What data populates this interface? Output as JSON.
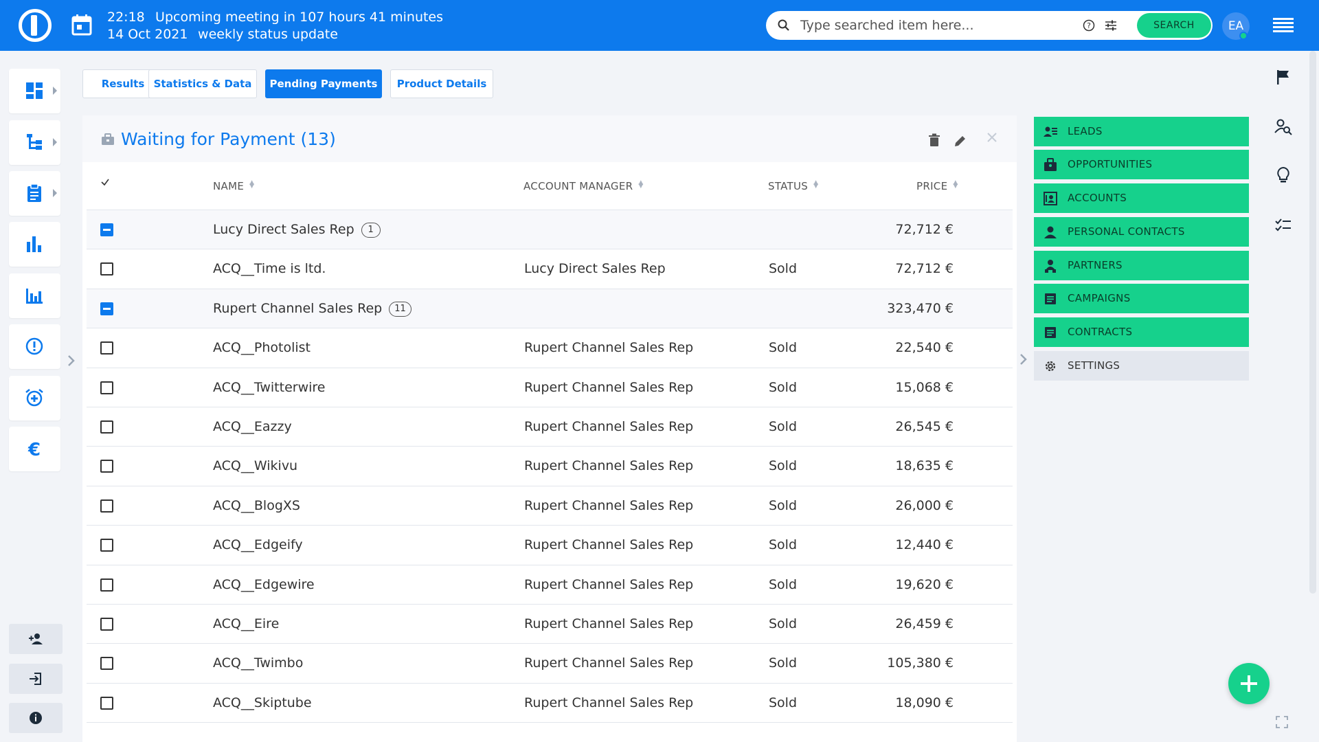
{
  "header": {
    "time": "22:18",
    "date": "14 Oct 2021",
    "meeting_line1": "Upcoming meeting in 107 hours 41 minutes",
    "meeting_line2": "weekly status update",
    "search_placeholder": "Type searched item here...",
    "search_button": "SEARCH",
    "avatar_initials": "EA"
  },
  "tabs": [
    "Results",
    "Statistics & Data",
    "Pending Payments",
    "Product Details"
  ],
  "active_tab": "Pending Payments",
  "panel": {
    "title": "Waiting for Payment (13)",
    "columns": {
      "name": "NAME",
      "manager": "ACCOUNT MANAGER",
      "status": "STATUS",
      "price": "PRICE"
    },
    "rows": [
      {
        "type": "group",
        "name": "Lucy Direct Sales Rep",
        "count": "1",
        "price": "72,712 €"
      },
      {
        "type": "item",
        "name": "ACQ__Time is ltd.",
        "manager": "Lucy Direct Sales Rep",
        "status": "Sold",
        "price": "72,712 €"
      },
      {
        "type": "group",
        "name": "Rupert Channel Sales Rep",
        "count": "11",
        "price": "323,470 €"
      },
      {
        "type": "item",
        "name": "ACQ__Photolist",
        "manager": "Rupert Channel Sales Rep",
        "status": "Sold",
        "price": "22,540 €"
      },
      {
        "type": "item",
        "name": "ACQ__Twitterwire",
        "manager": "Rupert Channel Sales Rep",
        "status": "Sold",
        "price": "15,068 €"
      },
      {
        "type": "item",
        "name": "ACQ__Eazzy",
        "manager": "Rupert Channel Sales Rep",
        "status": "Sold",
        "price": "26,545 €"
      },
      {
        "type": "item",
        "name": "ACQ__Wikivu",
        "manager": "Rupert Channel Sales Rep",
        "status": "Sold",
        "price": "18,635 €"
      },
      {
        "type": "item",
        "name": "ACQ__BlogXS",
        "manager": "Rupert Channel Sales Rep",
        "status": "Sold",
        "price": "26,000 €"
      },
      {
        "type": "item",
        "name": "ACQ__Edgeify",
        "manager": "Rupert Channel Sales Rep",
        "status": "Sold",
        "price": "12,440 €"
      },
      {
        "type": "item",
        "name": "ACQ__Edgewire",
        "manager": "Rupert Channel Sales Rep",
        "status": "Sold",
        "price": "19,620 €"
      },
      {
        "type": "item",
        "name": "ACQ__Eire",
        "manager": "Rupert Channel Sales Rep",
        "status": "Sold",
        "price": "26,459 €"
      },
      {
        "type": "item",
        "name": "ACQ__Twimbo",
        "manager": "Rupert Channel Sales Rep",
        "status": "Sold",
        "price": "105,380 €"
      },
      {
        "type": "item",
        "name": "ACQ__Skiptube",
        "manager": "Rupert Channel Sales Rep",
        "status": "Sold",
        "price": "18,090 €"
      }
    ]
  },
  "right_menu": [
    {
      "label": "LEADS",
      "icon": "leads-icon"
    },
    {
      "label": "OPPORTUNITIES",
      "icon": "opportunities-icon"
    },
    {
      "label": "ACCOUNTS",
      "icon": "accounts-icon"
    },
    {
      "label": "PERSONAL CONTACTS",
      "icon": "person-icon"
    },
    {
      "label": "PARTNERS",
      "icon": "partners-icon"
    },
    {
      "label": "CAMPAIGNS",
      "icon": "campaigns-icon"
    },
    {
      "label": "CONTRACTS",
      "icon": "contracts-icon"
    },
    {
      "label": "SETTINGS",
      "icon": "gear-icon"
    }
  ],
  "colors": {
    "primary": "#0d7aed",
    "accent_green": "#16d18c",
    "background": "#f2f4f8"
  }
}
